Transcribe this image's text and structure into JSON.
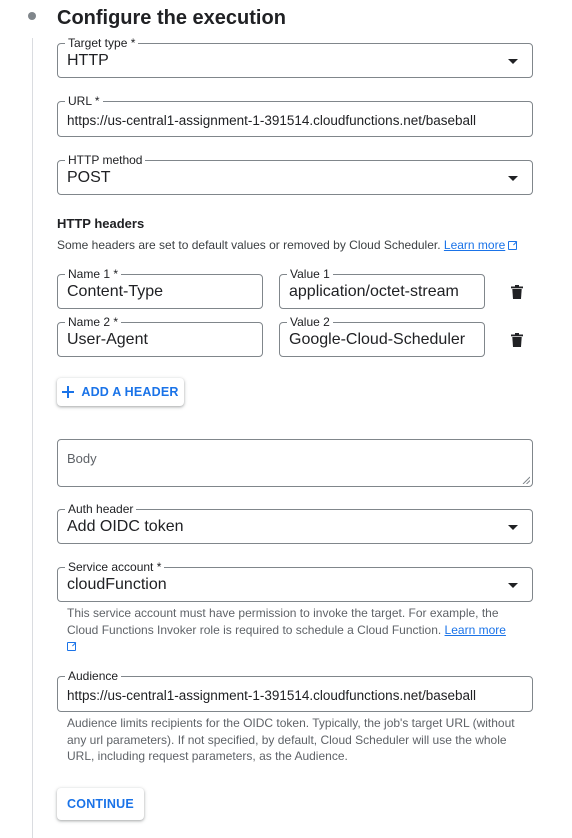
{
  "step": {
    "title": "Configure the execution"
  },
  "target_type": {
    "label": "Target type *",
    "value": "HTTP"
  },
  "url": {
    "label": "URL *",
    "value": "https://us-central1-assignment-1-391514.cloudfunctions.net/baseball"
  },
  "http_method": {
    "label": "HTTP method",
    "value": "POST"
  },
  "headers": {
    "title": "HTTP headers",
    "description": "Some headers are set to default values or removed by Cloud Scheduler.",
    "learn_more": "Learn more",
    "rows": [
      {
        "name_label": "Name 1 *",
        "name_value": "Content-Type",
        "value_label": "Value 1",
        "value_value": "application/octet-stream"
      },
      {
        "name_label": "Name 2 *",
        "name_value": "User-Agent",
        "value_label": "Value 2",
        "value_value": "Google-Cloud-Scheduler"
      }
    ],
    "add_button": "ADD A HEADER"
  },
  "body": {
    "placeholder": "Body"
  },
  "auth_header": {
    "label": "Auth header",
    "value": "Add OIDC token"
  },
  "service_account": {
    "label": "Service account *",
    "value": "cloudFunction",
    "help": "This service account must have permission to invoke the target. For example, the Cloud Functions Invoker role is required to schedule a Cloud Function.",
    "learn_more": "Learn more"
  },
  "audience": {
    "label": "Audience",
    "value": "https://us-central1-assignment-1-391514.cloudfunctions.net/baseball",
    "help": "Audience limits recipients for the OIDC token. Typically, the job's target URL (without any url parameters). If not specified, by default, Cloud Scheduler will use the whole URL, including request parameters, as the Audience."
  },
  "continue_button": "CONTINUE",
  "colors": {
    "accent": "#1a73e8",
    "text": "#202124",
    "border": "#80868b",
    "muted": "#5f6368"
  },
  "icons": [
    "step-dot",
    "dropdown-caret-icon",
    "external-link-icon",
    "delete-icon",
    "plus-icon"
  ]
}
